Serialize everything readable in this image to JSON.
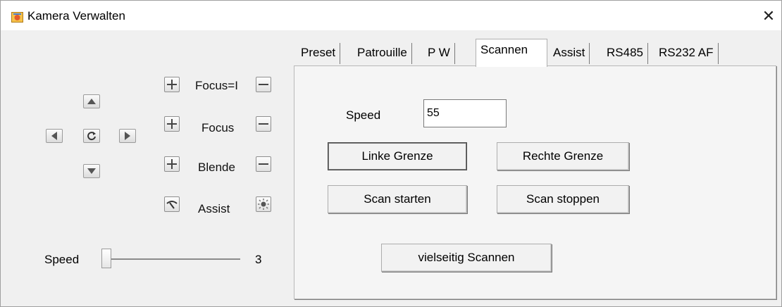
{
  "window": {
    "title": "Kamera Verwalten",
    "close_glyph": "✕"
  },
  "ptz": {
    "up_icon": "arrow-up-icon",
    "down_icon": "arrow-down-icon",
    "left_icon": "arrow-left-icon",
    "right_icon": "arrow-right-icon",
    "center_icon": "refresh-icon"
  },
  "lens": {
    "rows": [
      {
        "label": "Focus=I",
        "plus": "+",
        "minus": "−"
      },
      {
        "label": "Focus",
        "plus": "+",
        "minus": "−"
      },
      {
        "label": "Blende",
        "plus": "+",
        "minus": "−"
      },
      {
        "label": "Assist",
        "left_icon": "wiper-icon",
        "right_icon": "light-icon"
      }
    ]
  },
  "speed": {
    "label": "Speed",
    "value": "3"
  },
  "tabs": [
    {
      "label": "Preset"
    },
    {
      "label": "Patrouille"
    },
    {
      "label": "P  W"
    },
    {
      "label": "Scannen",
      "active": true
    },
    {
      "label": "Assist"
    },
    {
      "label": "RS485"
    },
    {
      "label": "RS232  AF"
    }
  ],
  "scan": {
    "speed_label": "Speed",
    "speed_value": "55",
    "left_limit_button": "Linke Grenze",
    "right_limit_button": "Rechte Grenze",
    "start_button": "Scan starten",
    "stop_button": "Scan stoppen",
    "multi_scan_button": "vielseitig Scannen"
  }
}
